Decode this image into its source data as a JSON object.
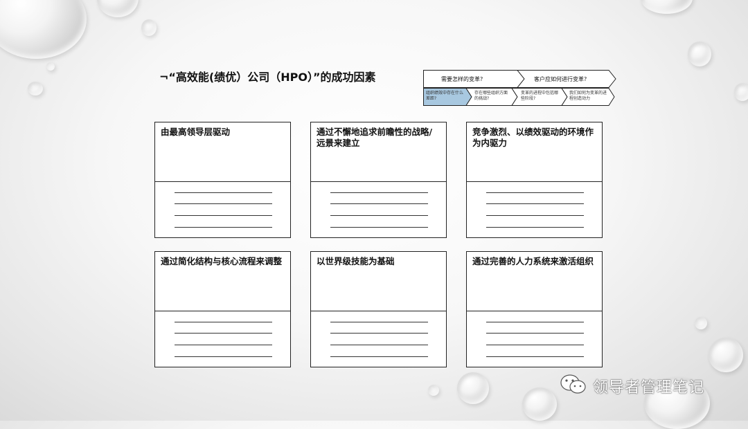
{
  "slide": {
    "title": "¬“高效能(绩优）公司（HPO）”的成功因素"
  },
  "process": {
    "stage1": "需要怎样的变革?",
    "stage2": "客户应如何进行变革?",
    "steps": [
      {
        "text": "组织绩效中存在什么差距?",
        "active": true
      },
      {
        "text": "存在哪些组织方面的挑战?",
        "active": false
      },
      {
        "text": "变革的进程中包括哪些阶段?",
        "active": false
      },
      {
        "text": "我们如何为变革的进程创造动力",
        "active": false
      }
    ],
    "active_color": "#a8c8e0"
  },
  "cards": [
    {
      "heading": "由最高领导层驱动"
    },
    {
      "heading": " 通过不懈地追求前瞻性的战略/远景来建立"
    },
    {
      "heading": "竞争激烈、以绩效驱动的环境作为内驱力"
    },
    {
      "heading": "通过简化结构与核心流程来调整"
    },
    {
      "heading": "以世界级技能为基础"
    },
    {
      "heading": "通过完善的人力系统来激活组织"
    }
  ],
  "watermark": {
    "icon": "wechat-icon",
    "text": "领导者管理笔记"
  }
}
